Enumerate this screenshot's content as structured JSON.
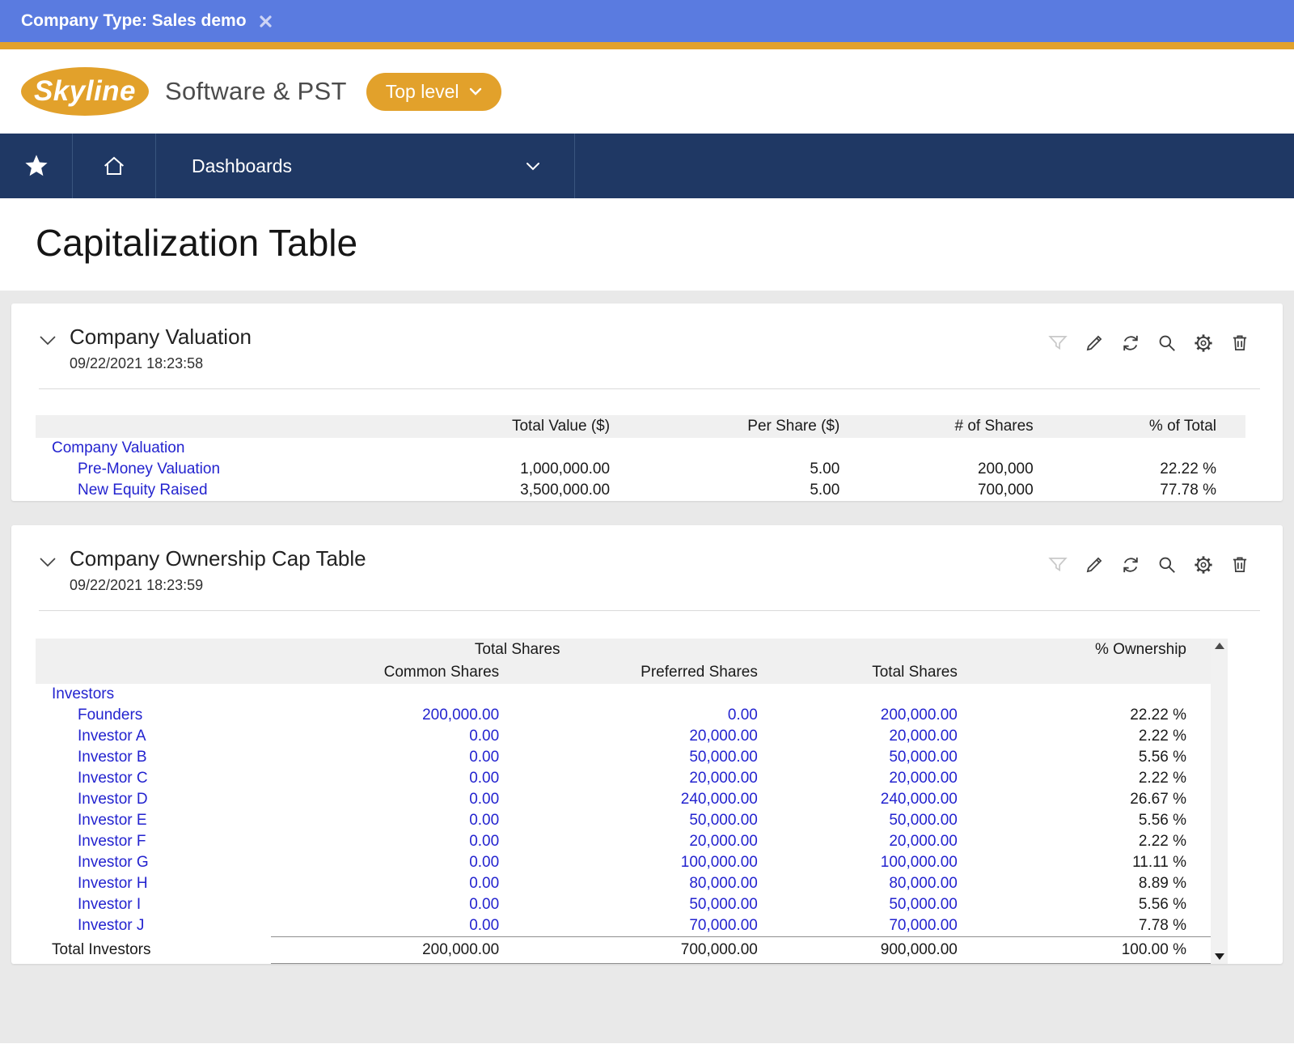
{
  "colors": {
    "accent_gold": "#e2a12b",
    "topbar_blue": "#5a7be0",
    "nav_navy": "#1f3864",
    "link_blue": "#2323cf"
  },
  "top_bar": {
    "label": "Company Type: Sales demo"
  },
  "header": {
    "logo_text": "Skyline",
    "subtitle": "Software & PST",
    "top_level_label": "Top level"
  },
  "nav": {
    "dashboards_label": "Dashboards"
  },
  "page": {
    "title": "Capitalization Table"
  },
  "toolbar": {
    "icons": [
      "filter-icon",
      "edit-icon",
      "refresh-icon",
      "search-icon",
      "settings-icon",
      "delete-icon"
    ]
  },
  "valuation": {
    "title": "Company Valuation",
    "timestamp": "09/22/2021 18:23:58",
    "headers": {
      "c1": "Total Value ($)",
      "c2": "Per Share ($)",
      "c3": "# of Shares",
      "c4": "% of Total"
    },
    "rows": [
      {
        "label": "Company Valuation",
        "v1": "",
        "v2": "",
        "v3": "",
        "v4": ""
      },
      {
        "label": "Pre-Money Valuation",
        "v1": "1,000,000.00",
        "v2": "5.00",
        "v3": "200,000",
        "v4": "22.22 %"
      },
      {
        "label": "New Equity Raised",
        "v1": "3,500,000.00",
        "v2": "5.00",
        "v3": "700,000",
        "v4": "77.78 %"
      }
    ]
  },
  "cap": {
    "title": "Company Ownership Cap Table",
    "timestamp": "09/22/2021 18:23:59",
    "group_headers": {
      "shares": "Total Shares",
      "ownership": "% Ownership"
    },
    "headers": {
      "common": "Common Shares",
      "preferred": "Preferred Shares",
      "total": "Total Shares"
    },
    "rows": [
      {
        "label": "Investors",
        "common": "",
        "preferred": "",
        "total": "",
        "ownership": ""
      },
      {
        "label": "Founders",
        "common": "200,000.00",
        "preferred": "0.00",
        "total": "200,000.00",
        "ownership": "22.22 %"
      },
      {
        "label": "Investor A",
        "common": "0.00",
        "preferred": "20,000.00",
        "total": "20,000.00",
        "ownership": "2.22 %"
      },
      {
        "label": "Investor B",
        "common": "0.00",
        "preferred": "50,000.00",
        "total": "50,000.00",
        "ownership": "5.56 %"
      },
      {
        "label": "Investor C",
        "common": "0.00",
        "preferred": "20,000.00",
        "total": "20,000.00",
        "ownership": "2.22 %"
      },
      {
        "label": "Investor D",
        "common": "0.00",
        "preferred": "240,000.00",
        "total": "240,000.00",
        "ownership": "26.67 %"
      },
      {
        "label": "Investor E",
        "common": "0.00",
        "preferred": "50,000.00",
        "total": "50,000.00",
        "ownership": "5.56 %"
      },
      {
        "label": "Investor F",
        "common": "0.00",
        "preferred": "20,000.00",
        "total": "20,000.00",
        "ownership": "2.22 %"
      },
      {
        "label": "Investor G",
        "common": "0.00",
        "preferred": "100,000.00",
        "total": "100,000.00",
        "ownership": "11.11 %"
      },
      {
        "label": "Investor H",
        "common": "0.00",
        "preferred": "80,000.00",
        "total": "80,000.00",
        "ownership": "8.89 %"
      },
      {
        "label": "Investor I",
        "common": "0.00",
        "preferred": "50,000.00",
        "total": "50,000.00",
        "ownership": "5.56 %"
      },
      {
        "label": "Investor J",
        "common": "0.00",
        "preferred": "70,000.00",
        "total": "70,000.00",
        "ownership": "7.78 %"
      }
    ],
    "total": {
      "label": "Total Investors",
      "common": "200,000.00",
      "preferred": "700,000.00",
      "total": "900,000.00",
      "ownership": "100.00 %"
    }
  }
}
